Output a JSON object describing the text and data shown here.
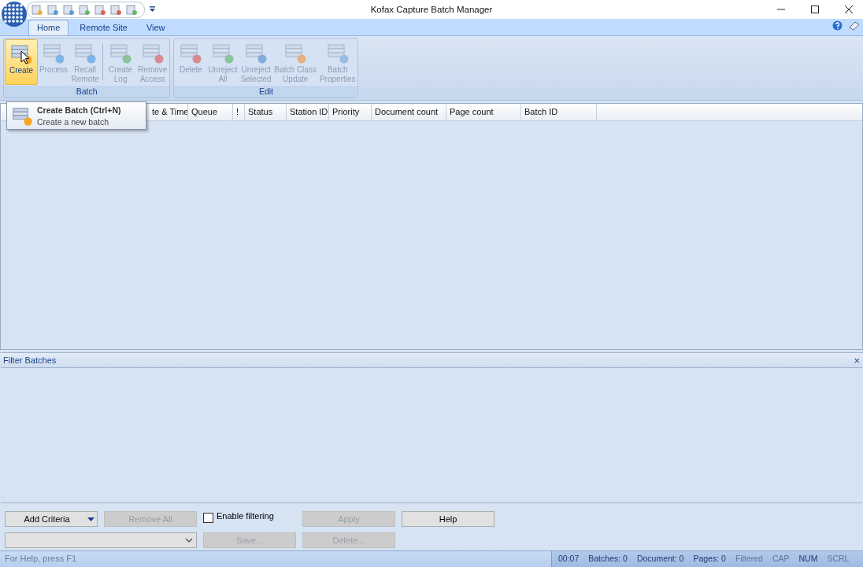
{
  "window": {
    "title": "Kofax Capture Batch Manager"
  },
  "ribbon_tabs": [
    {
      "label": "Home",
      "selected": true
    },
    {
      "label": "Remote Site",
      "selected": false
    },
    {
      "label": "View",
      "selected": false
    }
  ],
  "ribbon_groups": [
    {
      "label": "Batch",
      "buttons": [
        {
          "label": "Create",
          "disabled": false,
          "hot": true
        },
        {
          "label": "Process",
          "disabled": true,
          "hot": false
        },
        {
          "label": "Recall\nRemote",
          "disabled": true,
          "hot": false
        },
        {
          "label": "Create\nLog",
          "disabled": true,
          "hot": false
        },
        {
          "label": "Remove\nAccess",
          "disabled": true,
          "hot": false
        }
      ]
    },
    {
      "label": "Edit",
      "buttons": [
        {
          "label": "Delete",
          "disabled": true,
          "hot": false
        },
        {
          "label": "Unreject\nAll",
          "disabled": true,
          "hot": false
        },
        {
          "label": "Unreject\nSelected",
          "disabled": true,
          "hot": false
        },
        {
          "label": "Batch Class\nUpdate",
          "disabled": true,
          "hot": false
        },
        {
          "label": "Batch\nProperties",
          "disabled": true,
          "hot": false
        }
      ]
    }
  ],
  "tooltip": {
    "title": "Create Batch (Ctrl+N)",
    "description": "Create a new batch"
  },
  "table": {
    "columns": [
      "te & Time",
      "Queue",
      "!",
      "Status",
      "Station ID",
      "Priority",
      "Document count",
      "Page count",
      "Batch ID"
    ]
  },
  "filter_panel": {
    "title": "Filter Batches",
    "close": "×"
  },
  "filter_controls": {
    "add_criteria": "Add Criteria",
    "remove_all": {
      "label": "Remove All",
      "disabled": true
    },
    "enable_filtering": {
      "label": "Enable filtering",
      "checked": false
    },
    "apply": {
      "label": "Apply",
      "disabled": true
    },
    "help": {
      "label": "Help",
      "disabled": false
    },
    "save": {
      "label": "Save...",
      "disabled": true
    },
    "delete": {
      "label": "Delete...",
      "disabled": true
    }
  },
  "status_bar": {
    "hint": "For Help, press F1",
    "items": [
      {
        "text": "00:07",
        "on": true
      },
      {
        "text": "Batches: 0",
        "on": true
      },
      {
        "text": "Document: 0",
        "on": true
      },
      {
        "text": "Pages: 0",
        "on": true
      },
      {
        "text": "Filtered",
        "on": false
      },
      {
        "text": "CAP",
        "on": false
      },
      {
        "text": "NUM",
        "on": true
      },
      {
        "text": "SCRL",
        "on": false
      }
    ]
  }
}
